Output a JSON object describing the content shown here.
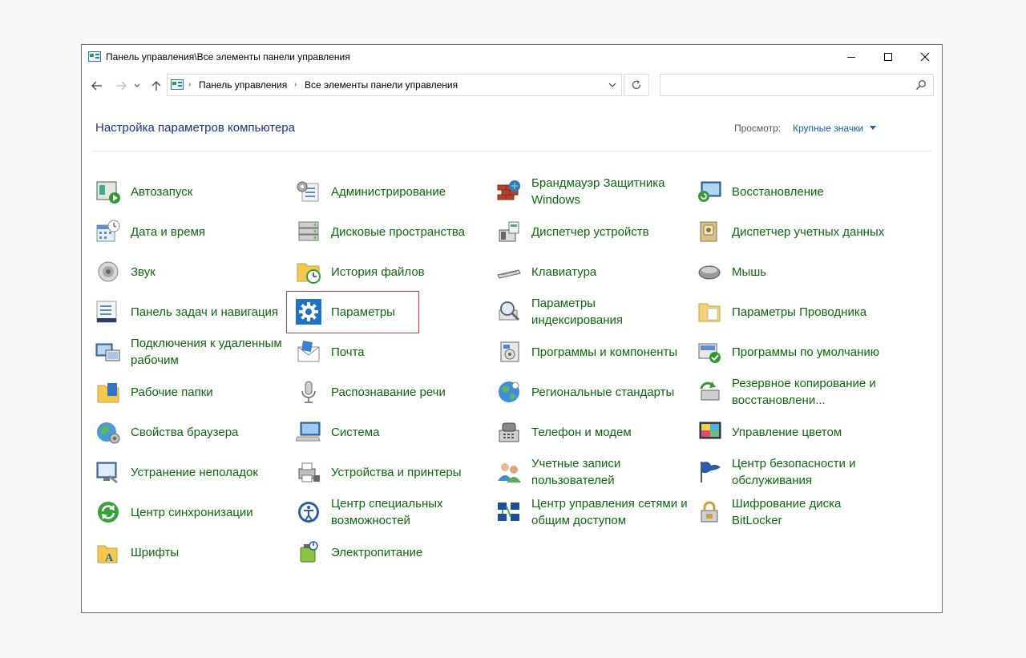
{
  "window": {
    "title": "Панель управления\\Все элементы панели управления"
  },
  "address_bar": {
    "crumbs": [
      "Панель управления",
      "Все элементы панели управления"
    ]
  },
  "search": {
    "placeholder": ""
  },
  "header": {
    "title": "Настройка параметров компьютера",
    "view_label": "Просмотр:",
    "view_value": "Крупные значки"
  },
  "colors": {
    "link": "#0b6a0b",
    "title": "#1e3287",
    "highlight": "#d43a3a"
  },
  "columns": [
    [
      {
        "label": "Автозапуск",
        "icon": "autoplay-icon"
      },
      {
        "label": "Дата и время",
        "icon": "calendar-clock-icon"
      },
      {
        "label": "Звук",
        "icon": "speaker-icon"
      },
      {
        "label": "Панель задач и навигация",
        "icon": "taskbar-icon"
      },
      {
        "label": "Подключения к удаленным рабочим",
        "icon": "remote-desktop-icon"
      },
      {
        "label": "Рабочие папки",
        "icon": "work-folders-icon"
      },
      {
        "label": "Свойства браузера",
        "icon": "internet-options-icon"
      },
      {
        "label": "Устранение неполадок",
        "icon": "troubleshooting-icon"
      },
      {
        "label": "Центр синхронизации",
        "icon": "sync-center-icon"
      },
      {
        "label": "Шрифты",
        "icon": "fonts-icon"
      }
    ],
    [
      {
        "label": "Администрирование",
        "icon": "admin-tools-icon"
      },
      {
        "label": "Дисковые пространства",
        "icon": "storage-spaces-icon"
      },
      {
        "label": "История файлов",
        "icon": "file-history-icon"
      },
      {
        "label": "Параметры",
        "icon": "settings-gear-icon"
      },
      {
        "label": "Почта",
        "icon": "mail-icon"
      },
      {
        "label": "Распознавание речи",
        "icon": "microphone-icon"
      },
      {
        "label": "Система",
        "icon": "system-icon"
      },
      {
        "label": "Устройства и принтеры",
        "icon": "printer-icon"
      },
      {
        "label": "Центр специальных возможностей",
        "icon": "accessibility-icon"
      },
      {
        "label": "Электропитание",
        "icon": "power-options-icon"
      }
    ],
    [
      {
        "label": "Брандмауэр Защитника Windows",
        "icon": "firewall-icon"
      },
      {
        "label": "Диспетчер устройств",
        "icon": "device-manager-icon"
      },
      {
        "label": "Клавиатура",
        "icon": "keyboard-icon"
      },
      {
        "label": "Параметры индексирования",
        "icon": "indexing-icon"
      },
      {
        "label": "Программы и компоненты",
        "icon": "programs-icon"
      },
      {
        "label": "Региональные стандарты",
        "icon": "region-globe-icon"
      },
      {
        "label": "Телефон и модем",
        "icon": "phone-modem-icon"
      },
      {
        "label": "Учетные записи пользователей",
        "icon": "user-accounts-icon"
      },
      {
        "label": "Центр управления сетями и общим доступом",
        "icon": "network-center-icon"
      }
    ],
    [
      {
        "label": "Восстановление",
        "icon": "recovery-icon"
      },
      {
        "label": "Диспетчер учетных данных",
        "icon": "credential-manager-icon"
      },
      {
        "label": "Мышь",
        "icon": "mouse-icon"
      },
      {
        "label": "Параметры Проводника",
        "icon": "explorer-options-icon"
      },
      {
        "label": "Программы по умолчанию",
        "icon": "default-programs-icon"
      },
      {
        "label": "Резервное копирование и восстановлени...",
        "icon": "backup-restore-icon"
      },
      {
        "label": "Управление цветом",
        "icon": "color-management-icon"
      },
      {
        "label": "Центр безопасности и обслуживания",
        "icon": "security-flag-icon"
      },
      {
        "label": "Шифрование диска BitLocker",
        "icon": "bitlocker-icon"
      }
    ]
  ]
}
